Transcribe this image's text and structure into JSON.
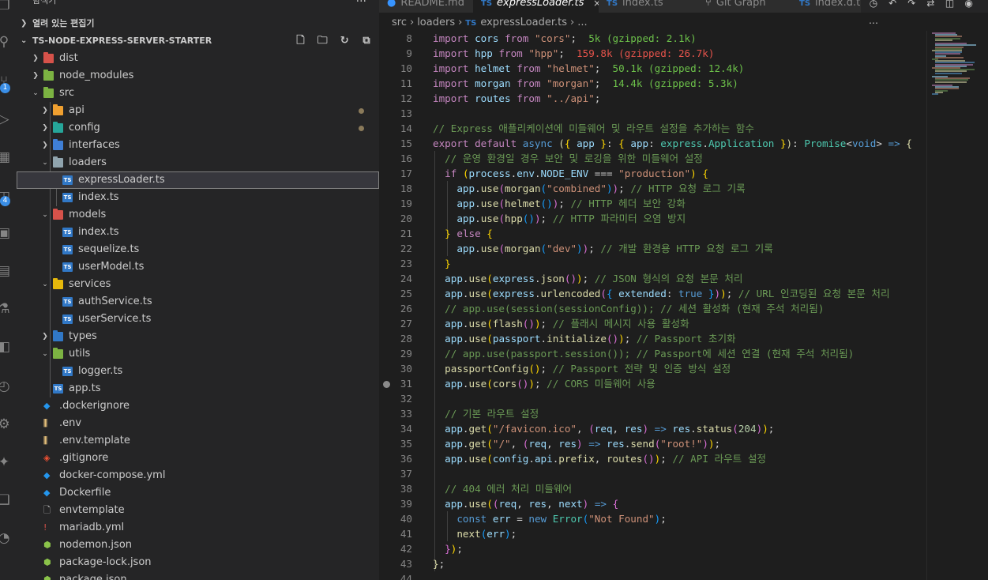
{
  "activity_bar": {
    "icons": [
      "explorer-icon",
      "search-icon",
      "source-control-icon",
      "run-debug-icon",
      "extensions-icon",
      "remote-icon",
      "docker-icon",
      "database-icon",
      "test-icon",
      "deploy-icon",
      "timeline-icon",
      "git-graph-icon",
      "accounts-icon"
    ],
    "badges": [
      "1",
      "4"
    ]
  },
  "sidebar": {
    "title": "탐색기",
    "open_editors_label": "열려 있는 편집기",
    "project_label": "TS-NODE-EXPRESS-SERVER-STARTER",
    "tree": [
      {
        "label": "dist",
        "icon": "folder-red"
      },
      {
        "label": "node_modules",
        "icon": "folder-green"
      },
      {
        "label": "src",
        "icon": "folder-green-open"
      },
      {
        "label": "api",
        "icon": "folder-orange"
      },
      {
        "label": "config",
        "icon": "folder-teal"
      },
      {
        "label": "interfaces",
        "icon": "folder-blue"
      },
      {
        "label": "loaders",
        "icon": "folder-gray-open"
      },
      {
        "label": "expressLoader.ts",
        "icon": "ts"
      },
      {
        "label": "index.ts",
        "icon": "ts"
      },
      {
        "label": "models",
        "icon": "folder-red-open"
      },
      {
        "label": "index.ts",
        "icon": "ts"
      },
      {
        "label": "sequelize.ts",
        "icon": "ts"
      },
      {
        "label": "userModel.ts",
        "icon": "ts"
      },
      {
        "label": "services",
        "icon": "folder-yellow-open"
      },
      {
        "label": "authService.ts",
        "icon": "ts"
      },
      {
        "label": "userService.ts",
        "icon": "ts"
      },
      {
        "label": "types",
        "icon": "ts-folder"
      },
      {
        "label": "utils",
        "icon": "folder-green-open"
      },
      {
        "label": "logger.ts",
        "icon": "ts"
      },
      {
        "label": "app.ts",
        "icon": "ts"
      },
      {
        "label": ".dockerignore",
        "icon": "docker"
      },
      {
        "label": ".env",
        "icon": "env"
      },
      {
        "label": ".env.template",
        "icon": "env"
      },
      {
        "label": ".gitignore",
        "icon": "git"
      },
      {
        "label": "docker-compose.yml",
        "icon": "docker"
      },
      {
        "label": "Dockerfile",
        "icon": "docker"
      },
      {
        "label": "envtemplate",
        "icon": "file"
      },
      {
        "label": "mariadb.yml",
        "icon": "yml"
      },
      {
        "label": "nodemon.json",
        "icon": "json"
      },
      {
        "label": "package-lock.json",
        "icon": "json"
      },
      {
        "label": "package.json",
        "icon": "json"
      }
    ]
  },
  "tabs": [
    {
      "label": "README.md",
      "icon": "info-icon"
    },
    {
      "label": "expressLoader.ts",
      "icon": "ts",
      "active": true,
      "close": "×"
    },
    {
      "label": "index.ts",
      "icon": "ts"
    },
    {
      "label": "Git Graph",
      "icon": "git-graph-icon"
    },
    {
      "label": "index.d.t",
      "icon": "ts"
    }
  ],
  "breadcrumb": [
    "src",
    "loaders",
    "expressLoader.ts",
    "..."
  ],
  "code": {
    "line_numbers": [
      "8",
      "9",
      "10",
      "11",
      "12",
      "13",
      "14",
      "15",
      "16",
      "17",
      "18",
      "19",
      "20",
      "21",
      "22",
      "23",
      "24",
      "25",
      "26",
      "27",
      "28",
      "29",
      "30",
      "31",
      "32",
      "33",
      "34",
      "35",
      "36",
      "37",
      "38",
      "39",
      "40",
      "41",
      "42",
      "43",
      "44"
    ],
    "sizes": {
      "cors": "5k (gzipped: 2.1k)",
      "hpp": "159.8k (gzipped: 26.7k)",
      "helmet": "50.1k (gzipped: 12.4k)",
      "morgan": "14.4k (gzipped: 5.3k)"
    },
    "comments": {
      "l14": "// Express 애플리케이션에 미들웨어 및 라우트 설정을 추가하는 함수",
      "l16": "// 운영 환경일 경우 보안 및 로깅을 위한 미들웨어 설정",
      "l18": "// HTTP 요청 로그 기록",
      "l19": "// HTTP 헤더 보안 강화",
      "l20": "// HTTP 파라미터 오염 방지",
      "l22": "// 개발 환경용 HTTP 요청 로그 기록",
      "l24": "// JSON 형식의 요청 본문 처리",
      "l25": "// URL 인코딩된 요청 본문 처리",
      "l26": "// app.use(session(sessionConfig)); // 세션 활성화 (현재 주석 처리됨)",
      "l27": "// 플래시 메시지 사용 활성화",
      "l28": "// Passport 초기화",
      "l29": "// app.use(passport.session()); // Passport에 세션 연결 (현재 주석 처리됨)",
      "l30": "// Passport 전략 및 인증 방식 설정",
      "l31": "// CORS 미들웨어 사용",
      "l33": "// 기본 라우트 설정",
      "l35": "// API 라우트 설정",
      "l38": "// 404 에러 처리 미들웨어"
    },
    "strings": {
      "cors": "\"cors\"",
      "hpp": "\"hpp\"",
      "helmet": "\"helmet\"",
      "morgan": "\"morgan\"",
      "routes": "\"../api\"",
      "production": "\"production\"",
      "combined": "\"combined\"",
      "dev": "\"dev\"",
      "favicon": "\"/favicon.ico\"",
      "root_path": "\"/\"",
      "root_msg": "\"root!\"",
      "not_found": "\"Not Found\""
    },
    "numbers": {
      "status": "204"
    }
  }
}
